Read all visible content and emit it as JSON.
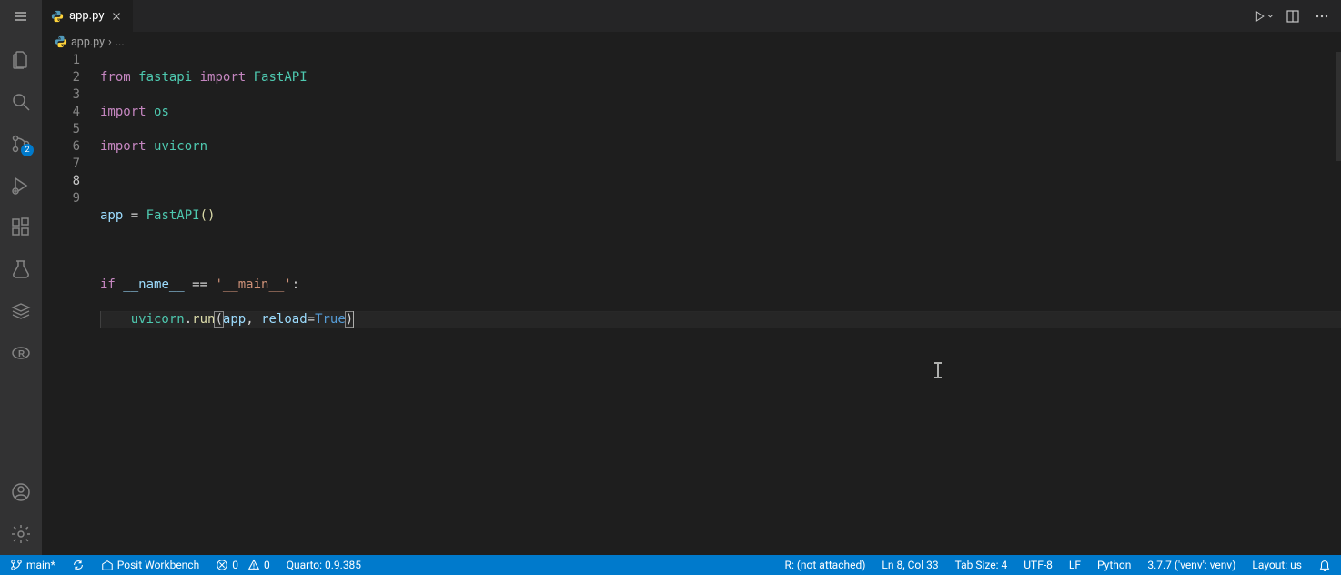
{
  "tab": {
    "filename": "app.py",
    "close_aria": "Close"
  },
  "breadcrumbs": {
    "file": "app.py",
    "more": "..."
  },
  "editor": {
    "line_count": 9,
    "current_line": 8
  },
  "code": {
    "l1": {
      "from": "from",
      "mod1": "fastapi",
      "import": "import",
      "cls": "FastAPI"
    },
    "l2": {
      "import": "import",
      "mod": "os"
    },
    "l3": {
      "import": "import",
      "mod": "uvicorn"
    },
    "l5": {
      "var": "app",
      "eq": " = ",
      "cls": "FastAPI",
      "parens": "()"
    },
    "l7": {
      "if": "if",
      "name": "__name__",
      "eq": " == ",
      "str": "'__main__'",
      "colon": ":"
    },
    "l8": {
      "mod": "uvicorn",
      "dot": ".",
      "fn": "run",
      "lp": "(",
      "arg1": "app",
      "comma": ", ",
      "kwarg": "reload",
      "eq2": "=",
      "val": "True",
      "rp": ")"
    }
  },
  "activitybar": {
    "scm_badge": "2"
  },
  "statusbar": {
    "branch": "main*",
    "remote_sync": "",
    "workbench": "Posit Workbench",
    "errors": "0",
    "warnings": "0",
    "quarto": "Quarto: 0.9.385",
    "r_status": "R: (not attached)",
    "cursor": "Ln 8, Col 33",
    "tabsize": "Tab Size: 4",
    "encoding": "UTF-8",
    "eol": "LF",
    "lang": "Python",
    "interpreter": "3.7.7 ('venv': venv)",
    "layout": "Layout: us"
  }
}
